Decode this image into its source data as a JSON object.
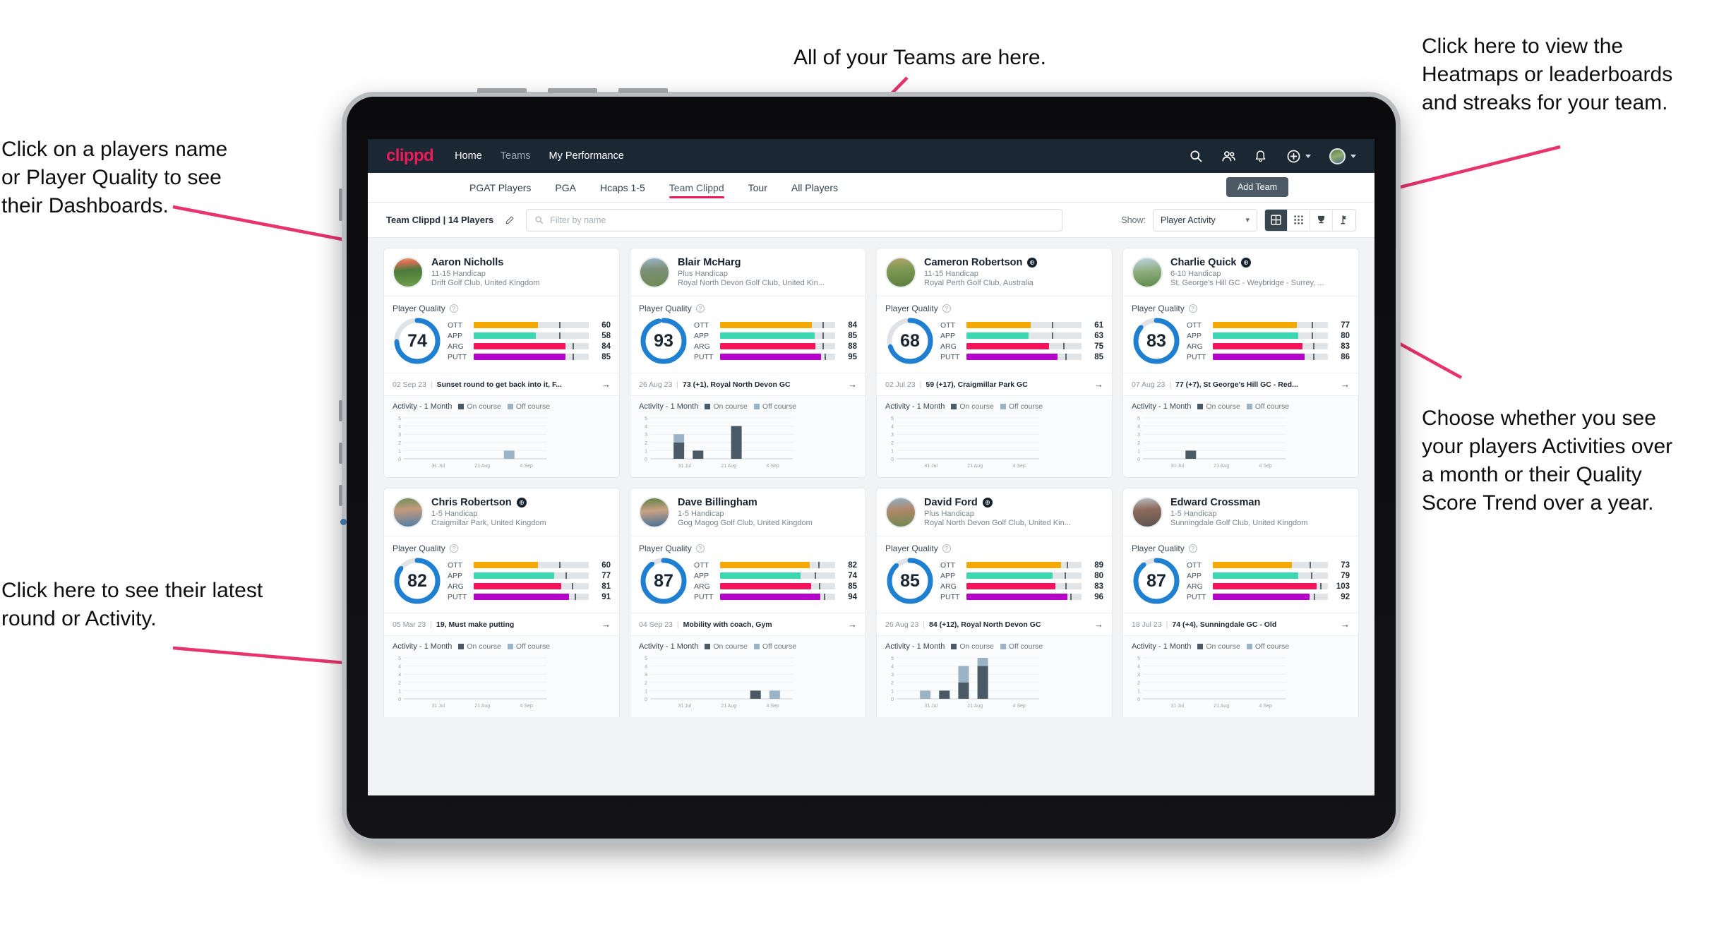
{
  "annotations": [
    {
      "id": "players-name",
      "text": "Click on a players name\nor Player Quality to see\ntheir Dashboards."
    },
    {
      "id": "latest-round",
      "text": "Click here to see their latest\nround or Activity."
    },
    {
      "id": "teams-tabs",
      "text": "All of your Teams are here."
    },
    {
      "id": "heatmaps",
      "text": "Click here to view the\nHeatmaps or leaderboards\nand streaks for your team."
    },
    {
      "id": "activity-toggle",
      "text": "Choose whether you see\nyour players Activities over\na month or their Quality\nScore Trend over a year."
    }
  ],
  "colors": {
    "brand_pink": "#ec1b5a",
    "header_navy": "#1b2834",
    "ring_blue": "#1f7fd0",
    "ott": "#f5a800",
    "app": "#3ad7b0",
    "arg": "#f5145b",
    "putt": "#b400c8",
    "on_course": "#4a5a66",
    "off_course": "#9bb3c7",
    "annotation_arrow": "#e8336d"
  },
  "header": {
    "logo": "clippd",
    "nav": [
      {
        "label": "Home",
        "active": true
      },
      {
        "label": "Teams",
        "active": false
      },
      {
        "label": "My Performance",
        "active": true
      }
    ],
    "icons": [
      {
        "name": "search-icon"
      },
      {
        "name": "people-icon"
      },
      {
        "name": "bell-icon"
      },
      {
        "name": "plus-circle-icon"
      },
      {
        "name": "avatar"
      }
    ]
  },
  "subnav": {
    "tabs": [
      {
        "label": "PGAT Players",
        "active": false
      },
      {
        "label": "PGA",
        "active": false
      },
      {
        "label": "Hcaps 1-5",
        "active": false
      },
      {
        "label": "Team Clippd",
        "active": true
      },
      {
        "label": "Tour",
        "active": false
      },
      {
        "label": "All Players",
        "active": false
      }
    ],
    "add_team_label": "Add Team"
  },
  "toolbar": {
    "team_label": "Team Clippd | 14 Players",
    "edit_icon": "pencil-icon",
    "search_placeholder": "Filter by name",
    "show_label": "Show:",
    "show_value": "Player Activity",
    "show_options": [
      "Player Activity",
      "Quality Score Trend"
    ],
    "views": [
      {
        "name": "grid-view-icon",
        "active": true
      },
      {
        "name": "dense-grid-view-icon",
        "active": false
      },
      {
        "name": "trophy-view-icon",
        "active": false
      },
      {
        "name": "flag-view-icon",
        "active": false
      }
    ]
  },
  "card_labels": {
    "player_quality": "Player Quality",
    "activity": "Activity - 1 Month",
    "on_course": "On course",
    "off_course": "Off course",
    "arrow": "→"
  },
  "chart_data": {
    "type": "bar",
    "title": "Activity - 1 Month",
    "ylabel": "",
    "xlabel": "",
    "ylim": [
      0,
      5
    ],
    "yticks": [
      0,
      1,
      2,
      3,
      4,
      5
    ],
    "xticks": [
      "31 Jul",
      "21 Aug",
      "4 Sep"
    ],
    "grid": true,
    "legend": [
      "On course",
      "Off course"
    ],
    "legend_position": "top",
    "stacked": true,
    "panels": [
      {
        "player": "Aaron Nicholls",
        "bars": [
          {
            "slot": 5,
            "on": 0,
            "off": 1
          }
        ]
      },
      {
        "player": "Blair McHarg",
        "bars": [
          {
            "slot": 1,
            "on": 2,
            "off": 1
          },
          {
            "slot": 2,
            "on": 1,
            "off": 0
          },
          {
            "slot": 4,
            "on": 4,
            "off": 0
          }
        ]
      },
      {
        "player": "Cameron Robertson",
        "bars": []
      },
      {
        "player": "Charlie Quick",
        "bars": [
          {
            "slot": 2,
            "on": 1,
            "off": 0
          }
        ]
      },
      {
        "player": "Chris Robertson",
        "bars": []
      },
      {
        "player": "Dave Billingham",
        "bars": [
          {
            "slot": 5,
            "on": 1,
            "off": 0
          },
          {
            "slot": 6,
            "on": 0,
            "off": 1
          }
        ]
      },
      {
        "player": "David Ford",
        "bars": [
          {
            "slot": 1,
            "on": 0,
            "off": 1
          },
          {
            "slot": 2,
            "on": 1,
            "off": 0
          },
          {
            "slot": 3,
            "on": 2,
            "off": 2
          },
          {
            "slot": 4,
            "on": 4,
            "off": 1
          }
        ]
      },
      {
        "player": "Edward Crossman",
        "bars": []
      }
    ]
  },
  "players": [
    {
      "name": "Aaron Nicholls",
      "verified": false,
      "handicap": "11-15 Handicap",
      "club": "Drift Golf Club, United Kingdom",
      "quality": 74,
      "ring_pct": 74,
      "metrics": [
        {
          "label": "OTT",
          "value": 60,
          "fill_pct": 56,
          "tick_pct": 74
        },
        {
          "label": "APP",
          "value": 58,
          "fill_pct": 54,
          "tick_pct": 74
        },
        {
          "label": "ARG",
          "value": 84,
          "fill_pct": 80,
          "tick_pct": 86
        },
        {
          "label": "PUTT",
          "value": 85,
          "fill_pct": 80,
          "tick_pct": 86
        }
      ],
      "latest_date": "02 Sep 23",
      "latest_text": "Sunset round to get back into it, F...",
      "avatar_css": "linear-gradient(175deg,#e8a06a 0%,#d66f55 16%,#4a7a3a 42%,#6fa04a 100%)"
    },
    {
      "name": "Blair McHarg",
      "verified": false,
      "handicap": "Plus Handicap",
      "club": "Royal North Devon Golf Club, United Kin...",
      "quality": 93,
      "ring_pct": 96,
      "metrics": [
        {
          "label": "OTT",
          "value": 84,
          "fill_pct": 80,
          "tick_pct": 89
        },
        {
          "label": "APP",
          "value": 85,
          "fill_pct": 82,
          "tick_pct": 89
        },
        {
          "label": "ARG",
          "value": 88,
          "fill_pct": 83,
          "tick_pct": 89
        },
        {
          "label": "PUTT",
          "value": 95,
          "fill_pct": 88,
          "tick_pct": 91
        }
      ],
      "latest_date": "26 Aug 23",
      "latest_text": "73 (+1), Royal North Devon GC",
      "avatar_css": "linear-gradient(175deg,#9bb7c9 0%,#7e8f78 40%,#6d8a52 100%)"
    },
    {
      "name": "Cameron Robertson",
      "verified": true,
      "handicap": "11-15 Handicap",
      "club": "Royal Perth Golf Club, Australia",
      "quality": 68,
      "ring_pct": 70,
      "metrics": [
        {
          "label": "OTT",
          "value": 61,
          "fill_pct": 56,
          "tick_pct": 74
        },
        {
          "label": "APP",
          "value": 63,
          "fill_pct": 54,
          "tick_pct": 74
        },
        {
          "label": "ARG",
          "value": 75,
          "fill_pct": 72,
          "tick_pct": 84
        },
        {
          "label": "PUTT",
          "value": 85,
          "fill_pct": 79,
          "tick_pct": 86
        }
      ],
      "latest_date": "02 Jul 23",
      "latest_text": "59 (+17), Craigmillar Park GC",
      "avatar_css": "linear-gradient(175deg,#b7a46a 0%,#7f9a55 38%,#5d7c3e 100%)"
    },
    {
      "name": "Charlie Quick",
      "verified": true,
      "handicap": "6-10 Handicap",
      "club": "St. George's Hill GC - Weybridge - Surrey, ...",
      "quality": 83,
      "ring_pct": 86,
      "metrics": [
        {
          "label": "OTT",
          "value": 77,
          "fill_pct": 73,
          "tick_pct": 86
        },
        {
          "label": "APP",
          "value": 80,
          "fill_pct": 74,
          "tick_pct": 86
        },
        {
          "label": "ARG",
          "value": 83,
          "fill_pct": 78,
          "tick_pct": 87
        },
        {
          "label": "PUTT",
          "value": 86,
          "fill_pct": 80,
          "tick_pct": 87
        }
      ],
      "latest_date": "07 Aug 23",
      "latest_text": "77 (+7), St George's Hill GC - Red...",
      "avatar_css": "linear-gradient(175deg,#bcd4e6 0%,#8fae7e 45%,#5f8a4a 100%)"
    },
    {
      "name": "Chris Robertson",
      "verified": true,
      "handicap": "1-5 Handicap",
      "club": "Craigmillar Park, United Kingdom",
      "quality": 82,
      "ring_pct": 85,
      "metrics": [
        {
          "label": "OTT",
          "value": 60,
          "fill_pct": 56,
          "tick_pct": 74
        },
        {
          "label": "APP",
          "value": 77,
          "fill_pct": 70,
          "tick_pct": 80
        },
        {
          "label": "ARG",
          "value": 81,
          "fill_pct": 76,
          "tick_pct": 85
        },
        {
          "label": "PUTT",
          "value": 91,
          "fill_pct": 83,
          "tick_pct": 88
        }
      ],
      "latest_date": "05 Mar 23",
      "latest_text": "19, Must make putting",
      "avatar_css": "linear-gradient(175deg,#6c8f5a 0%,#c49a7c 40%,#4f7ea8 100%)"
    },
    {
      "name": "Dave Billingham",
      "verified": false,
      "handicap": "1-5 Handicap",
      "club": "Gog Magog Golf Club, United Kingdom",
      "quality": 87,
      "ring_pct": 90,
      "metrics": [
        {
          "label": "OTT",
          "value": 82,
          "fill_pct": 78,
          "tick_pct": 85
        },
        {
          "label": "APP",
          "value": 74,
          "fill_pct": 70,
          "tick_pct": 82
        },
        {
          "label": "ARG",
          "value": 85,
          "fill_pct": 79,
          "tick_pct": 86
        },
        {
          "label": "PUTT",
          "value": 94,
          "fill_pct": 87,
          "tick_pct": 90
        }
      ],
      "latest_date": "04 Sep 23",
      "latest_text": "Mobility with coach, Gym",
      "avatar_css": "linear-gradient(175deg,#5f8046 0%,#c9a183 44%,#3f6f99 100%)"
    },
    {
      "name": "David Ford",
      "verified": true,
      "handicap": "Plus Handicap",
      "club": "Royal North Devon Golf Club, United Kin...",
      "quality": 85,
      "ring_pct": 88,
      "metrics": [
        {
          "label": "OTT",
          "value": 89,
          "fill_pct": 82,
          "tick_pct": 87
        },
        {
          "label": "APP",
          "value": 80,
          "fill_pct": 75,
          "tick_pct": 85
        },
        {
          "label": "ARG",
          "value": 83,
          "fill_pct": 77,
          "tick_pct": 86
        },
        {
          "label": "PUTT",
          "value": 96,
          "fill_pct": 88,
          "tick_pct": 90
        }
      ],
      "latest_date": "26 Aug 23",
      "latest_text": "84 (+12), Royal North Devon GC",
      "avatar_css": "linear-gradient(175deg,#8fb0c4 0%,#b0876a 42%,#6d8a52 100%)"
    },
    {
      "name": "Edward Crossman",
      "verified": false,
      "handicap": "1-5 Handicap",
      "club": "Sunningdale Golf Club, United Kingdom",
      "quality": 87,
      "ring_pct": 89,
      "metrics": [
        {
          "label": "OTT",
          "value": 73,
          "fill_pct": 69,
          "tick_pct": 84
        },
        {
          "label": "APP",
          "value": 79,
          "fill_pct": 74,
          "tick_pct": 85
        },
        {
          "label": "ARG",
          "value": 103,
          "fill_pct": 90,
          "tick_pct": 93
        },
        {
          "label": "PUTT",
          "value": 92,
          "fill_pct": 84,
          "tick_pct": 88
        }
      ],
      "latest_date": "18 Jul 23",
      "latest_text": "74 (+4), Sunningdale GC - Old",
      "avatar_css": "linear-gradient(175deg,#b9bfc4 0%,#8e6a5a 40%,#5a5550 100%)"
    }
  ]
}
